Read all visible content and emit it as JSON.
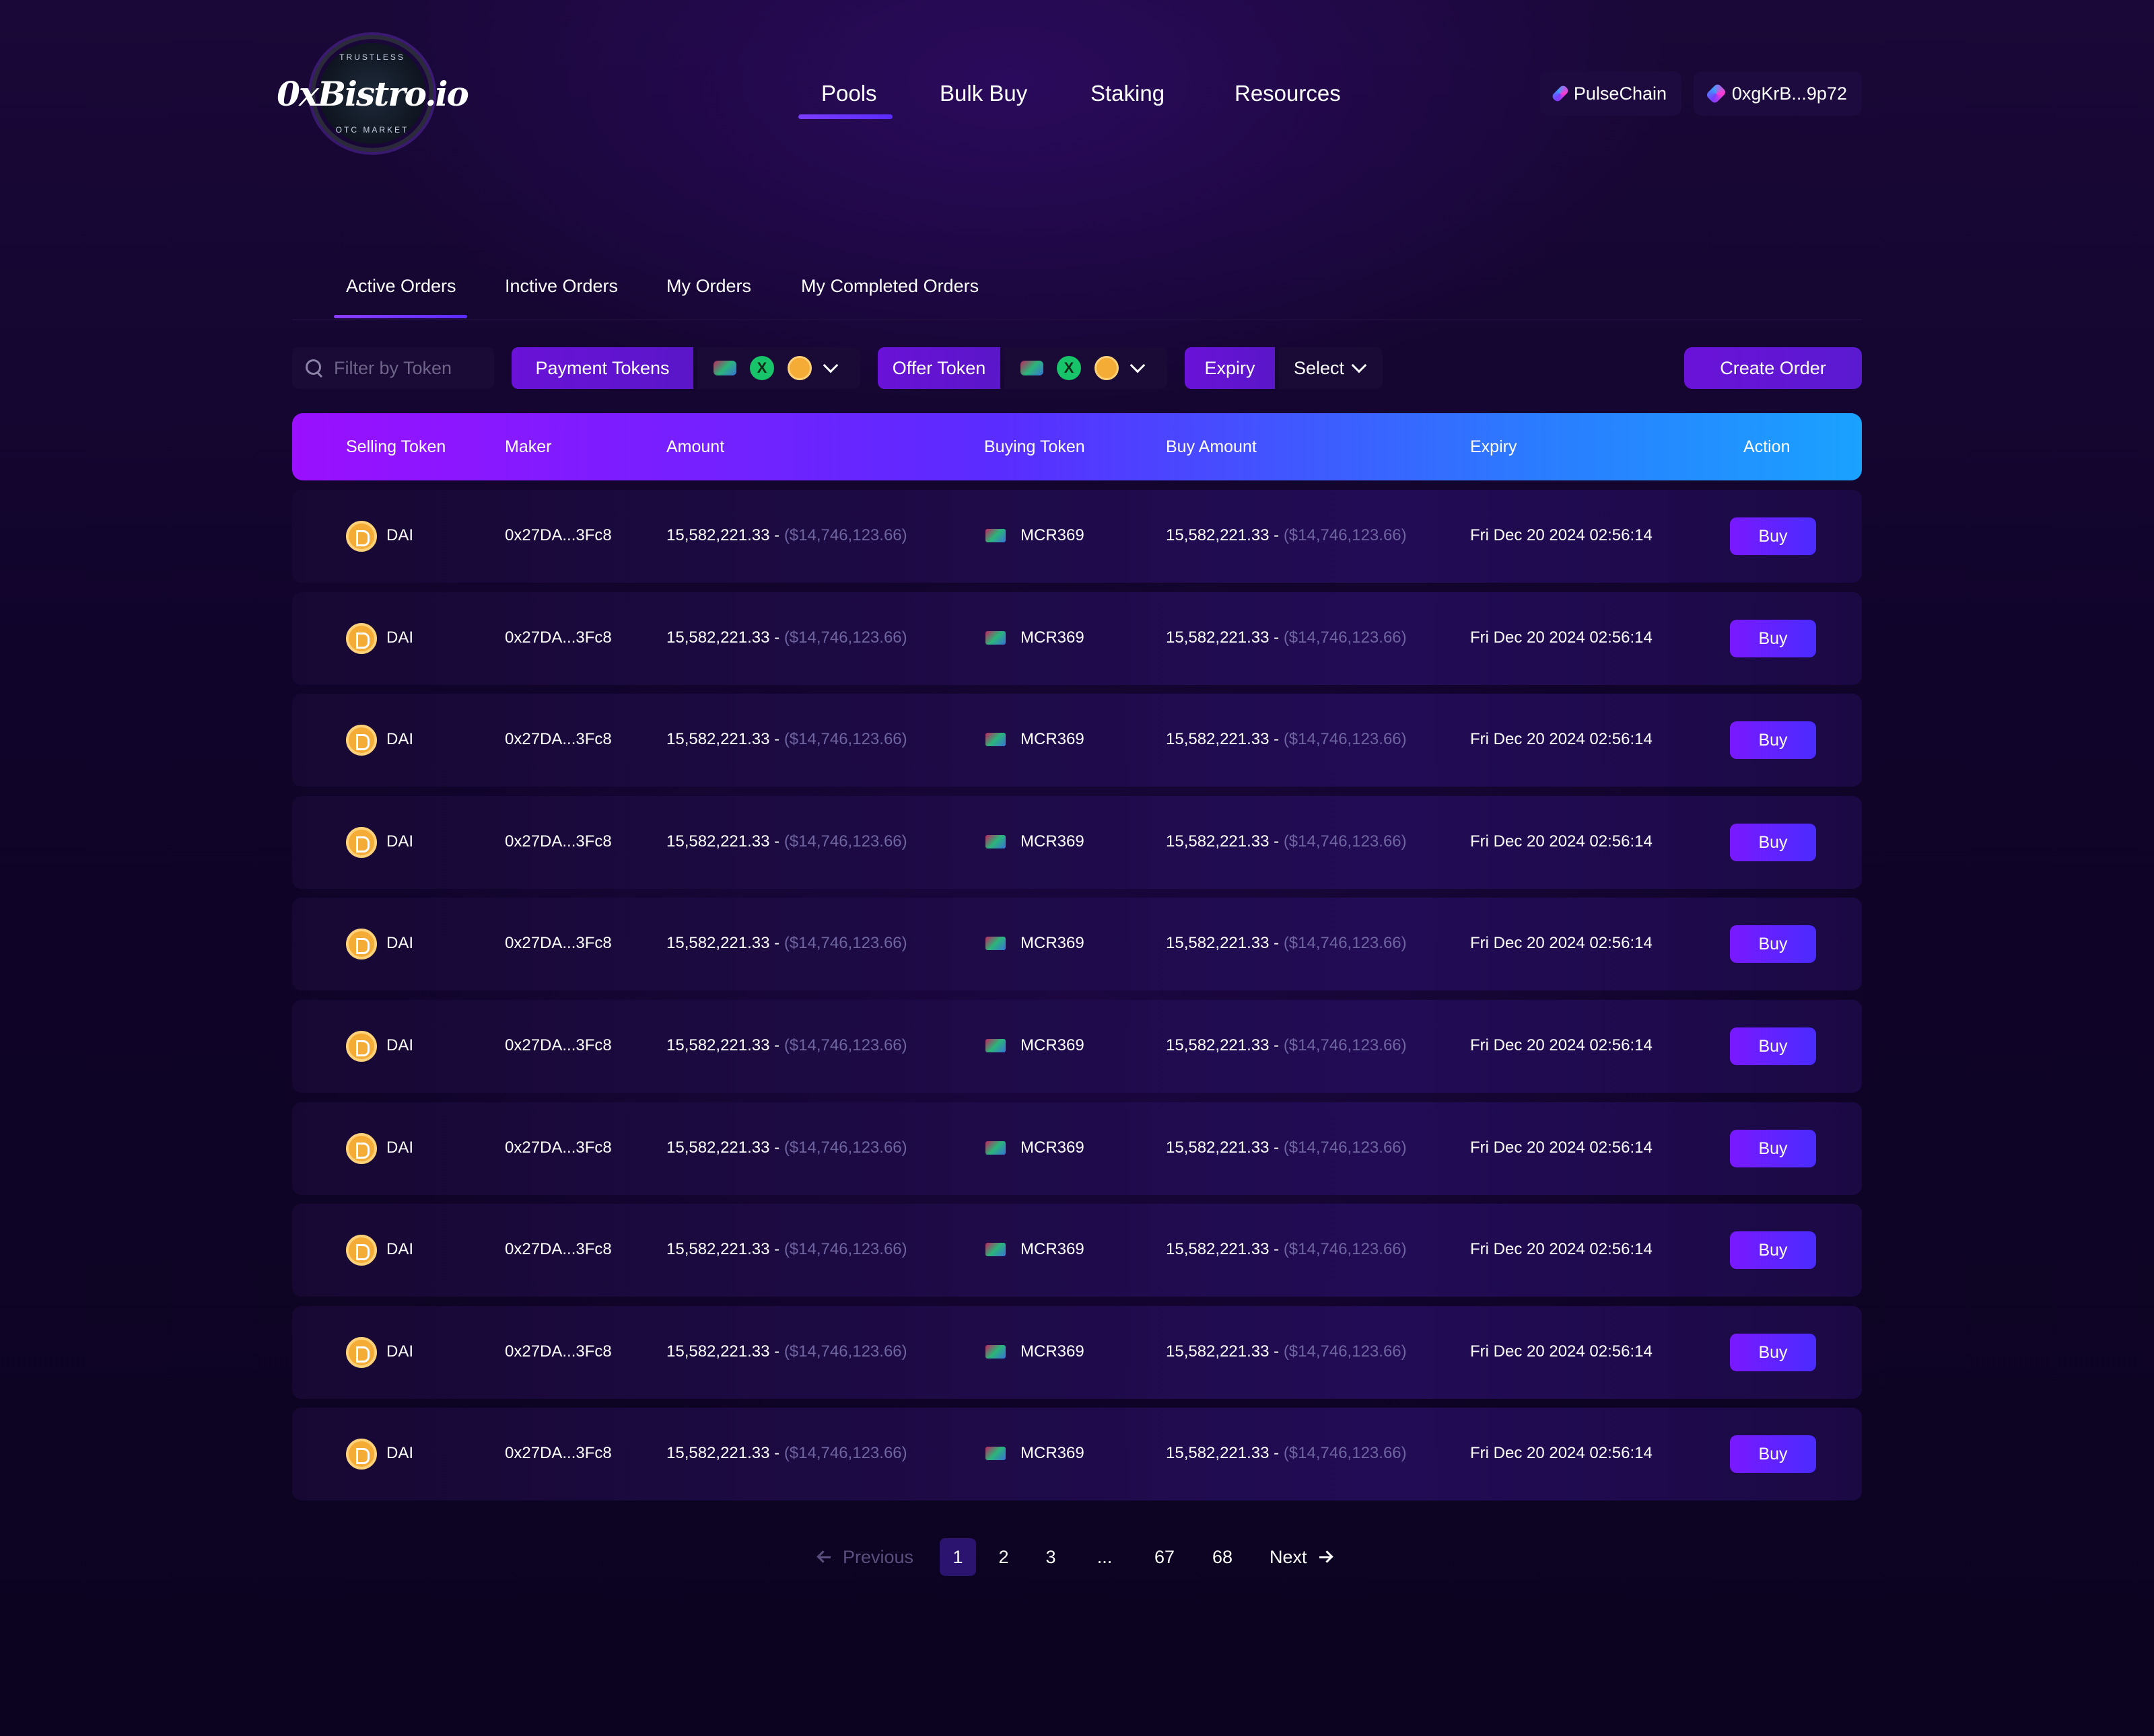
{
  "brand": {
    "logo_word": "0xBistro.io",
    "ring_top": "TRUSTLESS",
    "ring_bottom": "OTC MARKET"
  },
  "nav": {
    "items": [
      {
        "label": "Pools",
        "active": true
      },
      {
        "label": "Bulk Buy"
      },
      {
        "label": "Staking"
      },
      {
        "label": "Resources"
      }
    ]
  },
  "header": {
    "network_label": "PulseChain",
    "wallet_label": "0xgKrB...9p72"
  },
  "tabs": [
    {
      "label": "Active Orders",
      "active": true
    },
    {
      "label": "Inctive Orders"
    },
    {
      "label": "My Orders"
    },
    {
      "label": "My Completed Orders"
    }
  ],
  "filters": {
    "search_placeholder": "Filter by Token",
    "payment_tokens_label": "Payment Tokens",
    "offer_token_label": "Offer Token",
    "expiry_label": "Expiry",
    "expiry_select_label": "Select",
    "create_order_label": "Create Order",
    "token_icons": [
      "mcr369-icon",
      "x-token-icon",
      "dai-icon"
    ]
  },
  "table": {
    "columns": [
      "Selling Token",
      "Maker",
      "Amount",
      "Buying Token",
      "Buy Amount",
      "Expiry",
      "Action"
    ],
    "rows": [
      {
        "sell": "DAI",
        "maker": "0x27DA...3Fc8",
        "amount": "15,582,221.33 - ",
        "amount_usd": "($14,746,123.66)",
        "buy": "MCR369",
        "buy_amount": "15,582,221.33 - ",
        "buy_amount_usd": "($14,746,123.66)",
        "expiry": "Fri Dec 20 2024 02:56:14",
        "action": "Buy"
      },
      {
        "sell": "DAI",
        "maker": "0x27DA...3Fc8",
        "amount": "15,582,221.33 - ",
        "amount_usd": "($14,746,123.66)",
        "buy": "MCR369",
        "buy_amount": "15,582,221.33 - ",
        "buy_amount_usd": "($14,746,123.66)",
        "expiry": "Fri Dec 20 2024 02:56:14",
        "action": "Buy"
      },
      {
        "sell": "DAI",
        "maker": "0x27DA...3Fc8",
        "amount": "15,582,221.33 - ",
        "amount_usd": "($14,746,123.66)",
        "buy": "MCR369",
        "buy_amount": "15,582,221.33 - ",
        "buy_amount_usd": "($14,746,123.66)",
        "expiry": "Fri Dec 20 2024 02:56:14",
        "action": "Buy"
      },
      {
        "sell": "DAI",
        "maker": "0x27DA...3Fc8",
        "amount": "15,582,221.33 - ",
        "amount_usd": "($14,746,123.66)",
        "buy": "MCR369",
        "buy_amount": "15,582,221.33 - ",
        "buy_amount_usd": "($14,746,123.66)",
        "expiry": "Fri Dec 20 2024 02:56:14",
        "action": "Buy"
      },
      {
        "sell": "DAI",
        "maker": "0x27DA...3Fc8",
        "amount": "15,582,221.33 - ",
        "amount_usd": "($14,746,123.66)",
        "buy": "MCR369",
        "buy_amount": "15,582,221.33 - ",
        "buy_amount_usd": "($14,746,123.66)",
        "expiry": "Fri Dec 20 2024 02:56:14",
        "action": "Buy"
      },
      {
        "sell": "DAI",
        "maker": "0x27DA...3Fc8",
        "amount": "15,582,221.33 - ",
        "amount_usd": "($14,746,123.66)",
        "buy": "MCR369",
        "buy_amount": "15,582,221.33 - ",
        "buy_amount_usd": "($14,746,123.66)",
        "expiry": "Fri Dec 20 2024 02:56:14",
        "action": "Buy"
      },
      {
        "sell": "DAI",
        "maker": "0x27DA...3Fc8",
        "amount": "15,582,221.33 - ",
        "amount_usd": "($14,746,123.66)",
        "buy": "MCR369",
        "buy_amount": "15,582,221.33 - ",
        "buy_amount_usd": "($14,746,123.66)",
        "expiry": "Fri Dec 20 2024 02:56:14",
        "action": "Buy"
      },
      {
        "sell": "DAI",
        "maker": "0x27DA...3Fc8",
        "amount": "15,582,221.33 - ",
        "amount_usd": "($14,746,123.66)",
        "buy": "MCR369",
        "buy_amount": "15,582,221.33 - ",
        "buy_amount_usd": "($14,746,123.66)",
        "expiry": "Fri Dec 20 2024 02:56:14",
        "action": "Buy"
      },
      {
        "sell": "DAI",
        "maker": "0x27DA...3Fc8",
        "amount": "15,582,221.33 - ",
        "amount_usd": "($14,746,123.66)",
        "buy": "MCR369",
        "buy_amount": "15,582,221.33 - ",
        "buy_amount_usd": "($14,746,123.66)",
        "expiry": "Fri Dec 20 2024 02:56:14",
        "action": "Buy"
      },
      {
        "sell": "DAI",
        "maker": "0x27DA...3Fc8",
        "amount": "15,582,221.33 - ",
        "amount_usd": "($14,746,123.66)",
        "buy": "MCR369",
        "buy_amount": "15,582,221.33 - ",
        "buy_amount_usd": "($14,746,123.66)",
        "expiry": "Fri Dec 20 2024 02:56:14",
        "action": "Buy"
      }
    ]
  },
  "pagination": {
    "previous_label": "Previous",
    "next_label": "Next",
    "pages": [
      "1",
      "2",
      "3",
      "...",
      "67",
      "68"
    ],
    "current": "1"
  },
  "colors": {
    "accent": "#6a12d8",
    "header_gradient_start": "#9a10ff",
    "header_gradient_end": "#1aa2ff",
    "muted_text": "#6e65a0"
  }
}
